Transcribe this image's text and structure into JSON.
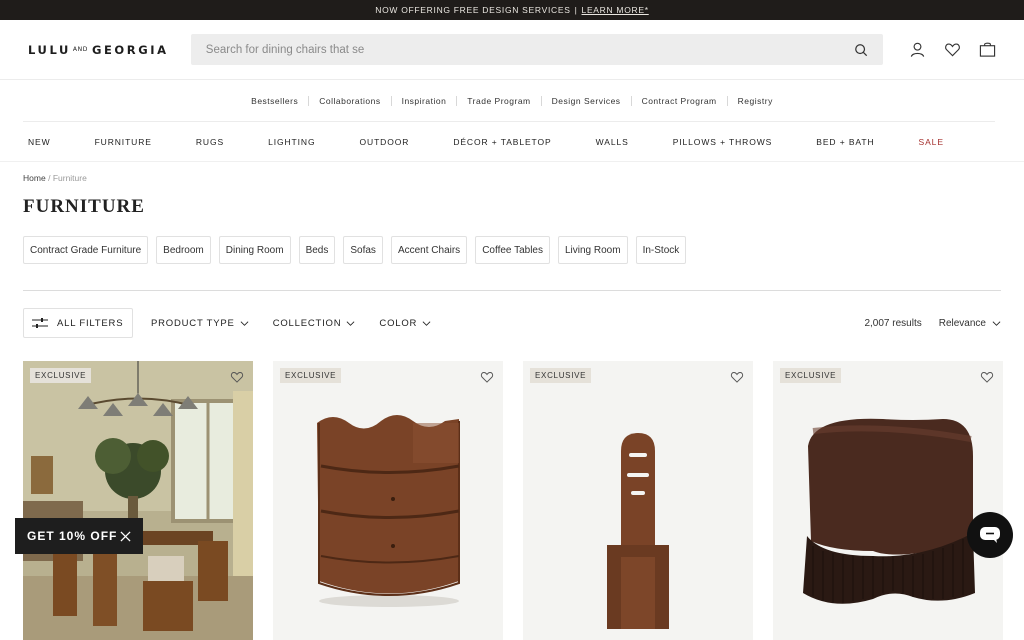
{
  "announcement": {
    "text": "NOW OFFERING FREE DESIGN SERVICES",
    "separator": "|",
    "link": "LEARN MORE*"
  },
  "header": {
    "logo_left": "LULU",
    "logo_and": "AND",
    "logo_right": "GEORGIA",
    "search_placeholder": "Search for dining chairs that se",
    "icons": [
      "search-icon",
      "account-icon",
      "wishlist-heart-icon",
      "cart-bag-icon"
    ]
  },
  "subnav": [
    "Bestsellers",
    "Collaborations",
    "Inspiration",
    "Trade Program",
    "Design Services",
    "Contract Program",
    "Registry"
  ],
  "mainnav": [
    "NEW",
    "FURNITURE",
    "RUGS",
    "LIGHTING",
    "OUTDOOR",
    "DÉCOR + TABLETOP",
    "WALLS",
    "PILLOWS + THROWS",
    "BED + BATH",
    "SALE"
  ],
  "breadcrumb": {
    "home": "Home",
    "separator": "/",
    "current": "Furniture"
  },
  "page_title": "FURNITURE",
  "chips": [
    "Contract Grade Furniture",
    "Bedroom",
    "Dining Room",
    "Beds",
    "Sofas",
    "Accent Chairs",
    "Coffee Tables",
    "Living Room",
    "In-Stock"
  ],
  "filters": {
    "all_filters": "ALL FILTERS",
    "dropdowns": [
      "PRODUCT TYPE",
      "COLLECTION",
      "COLOR"
    ],
    "results": "2,007 results",
    "sort": "Relevance"
  },
  "products": [
    {
      "badge": "EXCLUSIVE",
      "image": "dining-room-scene"
    },
    {
      "badge": "EXCLUSIVE",
      "image": "scalloped-wood-nightstand"
    },
    {
      "badge": "EXCLUSIVE",
      "image": "sculptural-wood-chair"
    },
    {
      "badge": "EXCLUSIVE",
      "image": "velvet-fringe-ottoman"
    }
  ],
  "promo": {
    "label": "GET 10% OFF"
  },
  "colors": {
    "sale": "#a5302e",
    "announcement_bg": "#1f1c1a",
    "search_bg": "#ededed",
    "badge_bg": "#e5e1d9"
  }
}
